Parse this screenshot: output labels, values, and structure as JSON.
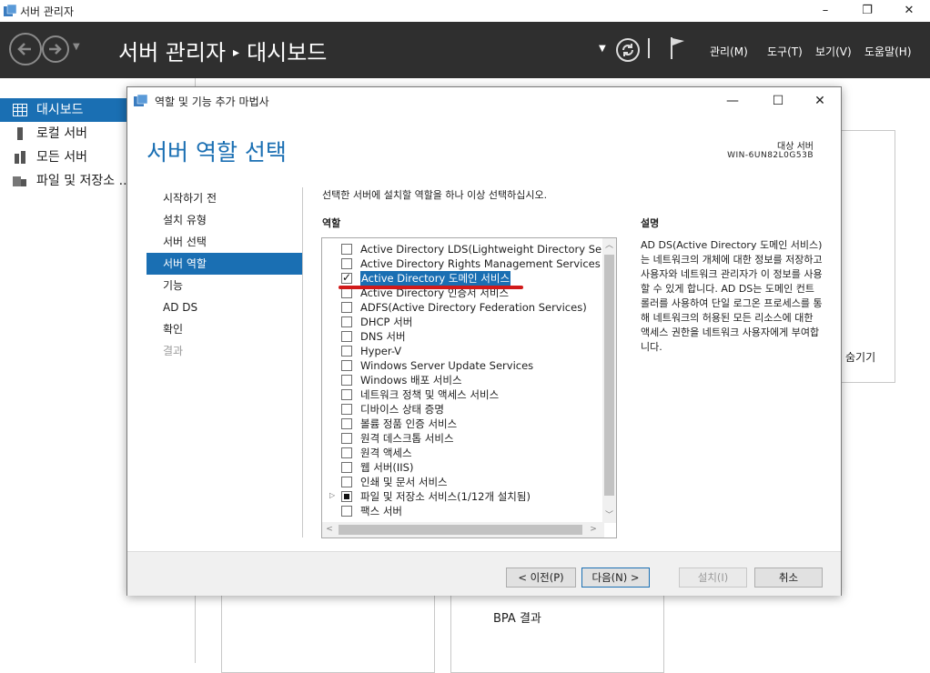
{
  "window": {
    "title": "서버 관리자"
  },
  "header": {
    "breadcrumb_root": "서버 관리자",
    "breadcrumb_sep": "▸",
    "breadcrumb_current": "대시보드",
    "menus": [
      "관리(M)",
      "도구(T)",
      "보기(V)",
      "도움말(H)"
    ]
  },
  "sidebar": {
    "items": [
      {
        "label": "대시보드",
        "icon": "dashboard-icon"
      },
      {
        "label": "로컬 서버",
        "icon": "server-icon"
      },
      {
        "label": "모든 서버",
        "icon": "servers-icon"
      },
      {
        "label": "파일 및 저장소 ...",
        "icon": "storage-icon"
      }
    ]
  },
  "background": {
    "hide_text": "숨기기",
    "bpa_text": "BPA 결과"
  },
  "dialog": {
    "title": "역할 및 기능 추가 마법사",
    "page_title": "서버 역할 선택",
    "target_label": "대상 서버",
    "target_name": "WIN-6UN82L0G53B",
    "steps": [
      "시작하기 전",
      "설치 유형",
      "서버 선택",
      "서버 역할",
      "기능",
      "AD DS",
      "확인",
      "결과"
    ],
    "instruction": "선택한 서버에 설치할 역할을 하나 이상 선택하십시오.",
    "roles_label": "역할",
    "description_label": "설명",
    "description": "AD DS(Active Directory 도메인 서비스)는 네트워크의 개체에 대한 정보를 저장하고 사용자와 네트워크 관리자가 이 정보를 사용할 수 있게 합니다. AD DS는 도메인 컨트롤러를 사용하여 단일 로그온 프로세스를 통해 네트워크의 허용된 모든 리소스에 대한 액세스 권한을 네트워크 사용자에게 부여합니다.",
    "roles": [
      {
        "label": "Active Directory LDS(Lightweight Directory Servic",
        "state": "unchecked"
      },
      {
        "label": "Active Directory Rights Management Services",
        "state": "unchecked"
      },
      {
        "label": "Active Directory 도메인 서비스",
        "state": "checked"
      },
      {
        "label": "Active Directory 인증서 서비스",
        "state": "unchecked"
      },
      {
        "label": "ADFS(Active Directory Federation Services)",
        "state": "unchecked"
      },
      {
        "label": "DHCP 서버",
        "state": "unchecked"
      },
      {
        "label": "DNS 서버",
        "state": "unchecked"
      },
      {
        "label": "Hyper-V",
        "state": "unchecked"
      },
      {
        "label": "Windows Server Update Services",
        "state": "unchecked"
      },
      {
        "label": "Windows 배포 서비스",
        "state": "unchecked"
      },
      {
        "label": "네트워크 정책 및 액세스 서비스",
        "state": "unchecked"
      },
      {
        "label": "디바이스 상태 증명",
        "state": "unchecked"
      },
      {
        "label": "볼륨 정품 인증 서비스",
        "state": "unchecked"
      },
      {
        "label": "원격 데스크톱 서비스",
        "state": "unchecked"
      },
      {
        "label": "원격 액세스",
        "state": "unchecked"
      },
      {
        "label": "웹 서버(IIS)",
        "state": "unchecked"
      },
      {
        "label": "인쇄 및 문서 서비스",
        "state": "unchecked"
      },
      {
        "label": "파일 및 저장소 서비스(1/12개 설치됨)",
        "state": "partial"
      },
      {
        "label": "팩스 서버",
        "state": "unchecked"
      }
    ],
    "buttons": {
      "prev": "< 이전(P)",
      "next": "다음(N) >",
      "install": "설치(I)",
      "cancel": "취소"
    }
  },
  "colors": {
    "accent": "#1a6fb3",
    "header_bg": "#2f2f2f",
    "annotation": "#d11a1a"
  }
}
